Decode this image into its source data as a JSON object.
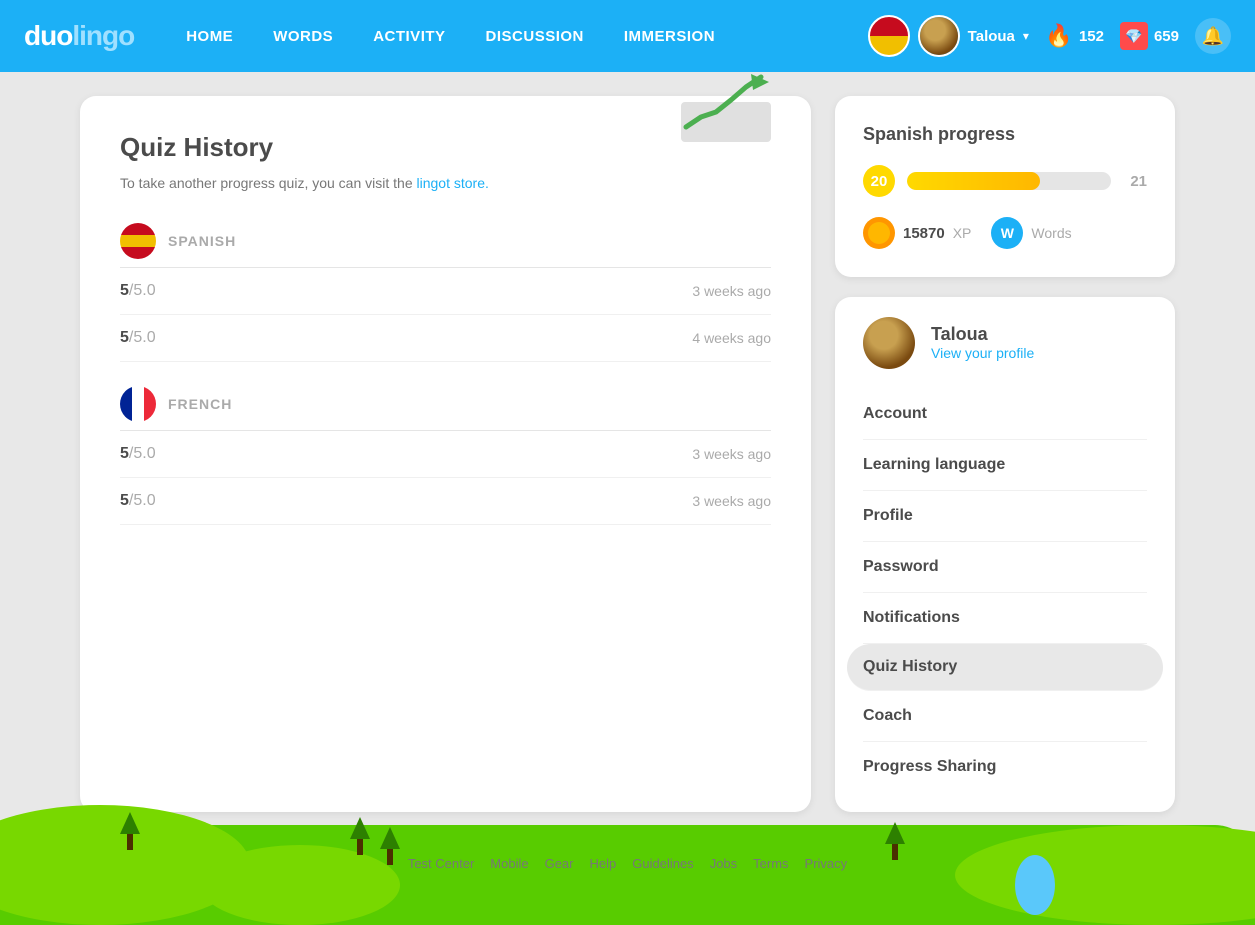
{
  "navbar": {
    "logo": "duolingo",
    "links": [
      {
        "id": "home",
        "label": "Home"
      },
      {
        "id": "words",
        "label": "Words"
      },
      {
        "id": "activity",
        "label": "Activity"
      },
      {
        "id": "discussion",
        "label": "Discussion"
      },
      {
        "id": "immersion",
        "label": "Immersion"
      }
    ],
    "user": {
      "name": "Taloua",
      "streak": "152",
      "gems": "659"
    }
  },
  "quiz_history": {
    "title": "Quiz History",
    "subtitle_pre": "To take another progress quiz, you can visit the ",
    "subtitle_link": "lingot store.",
    "languages": [
      {
        "id": "spanish",
        "name": "SPANISH",
        "scores": [
          {
            "score": "5",
            "total": "/5.0",
            "time": "3 weeks ago"
          },
          {
            "score": "5",
            "total": "/5.0",
            "time": "4 weeks ago"
          }
        ]
      },
      {
        "id": "french",
        "name": "FRENCH",
        "scores": [
          {
            "score": "5",
            "total": "/5.0",
            "time": "3 weeks ago"
          },
          {
            "score": "5",
            "total": "/5.0",
            "time": "3 weeks ago"
          }
        ]
      }
    ]
  },
  "spanish_progress": {
    "title": "Spanish progress",
    "level_current": "20",
    "level_next": "21",
    "progress_pct": 65,
    "xp": "15870",
    "xp_label": "XP",
    "words_label": "Words"
  },
  "profile_menu": {
    "username": "Taloua",
    "view_profile_link": "View your profile",
    "items": [
      {
        "id": "account",
        "label": "Account",
        "active": false
      },
      {
        "id": "learning-language",
        "label": "Learning language",
        "active": false
      },
      {
        "id": "profile",
        "label": "Profile",
        "active": false
      },
      {
        "id": "password",
        "label": "Password",
        "active": false
      },
      {
        "id": "notifications",
        "label": "Notifications",
        "active": false
      },
      {
        "id": "quiz-history",
        "label": "Quiz History",
        "active": true
      },
      {
        "id": "coach",
        "label": "Coach",
        "active": false
      },
      {
        "id": "progress-sharing",
        "label": "Progress Sharing",
        "active": false
      }
    ]
  },
  "footer": {
    "links": [
      "Test Center",
      "Mobile",
      "Gear",
      "Help",
      "Guidelines",
      "Jobs",
      "Terms",
      "Privacy"
    ]
  }
}
